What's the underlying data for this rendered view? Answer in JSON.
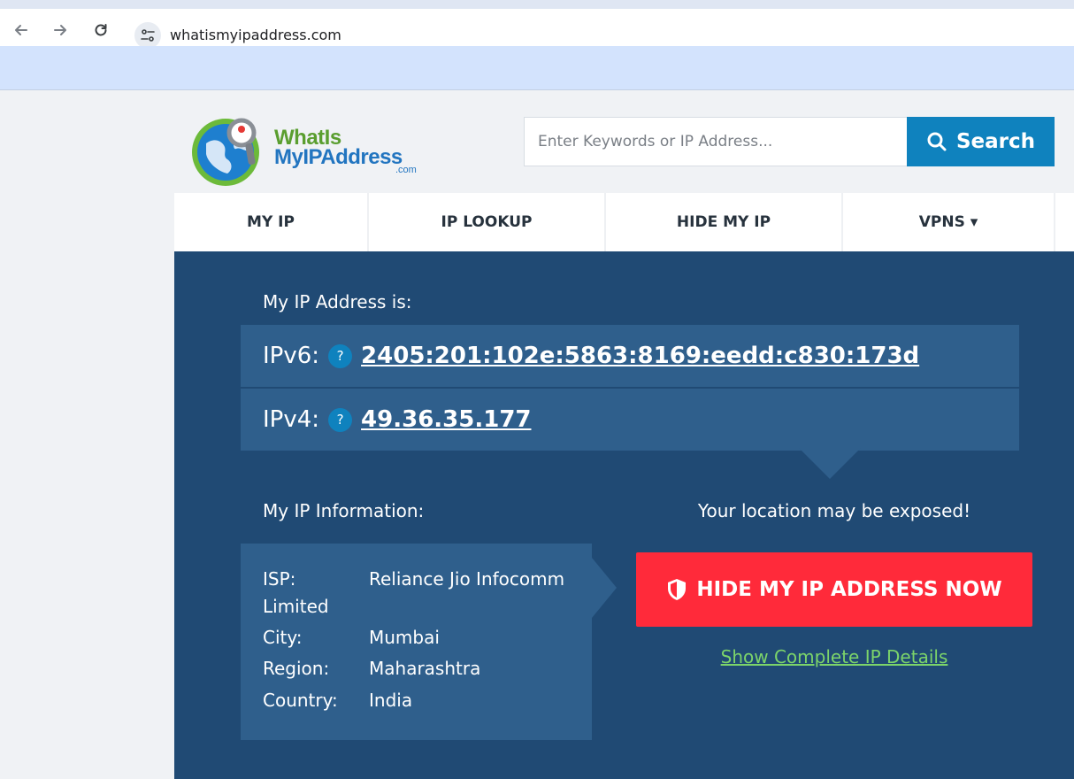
{
  "browser": {
    "url": "whatismyipaddress.com",
    "icons": [
      "back-arrow-icon",
      "forward-arrow-icon",
      "reload-icon",
      "site-settings-icon",
      "apps-grid-icon"
    ]
  },
  "site": {
    "logo": {
      "line1": "WhatIs",
      "line2": "MyIPAddress",
      "line3": ".com"
    },
    "search": {
      "placeholder": "Enter Keywords or IP Address...",
      "button_label": "Search"
    },
    "nav": [
      {
        "label": "MY IP"
      },
      {
        "label": "IP LOOKUP"
      },
      {
        "label": "HIDE MY IP"
      },
      {
        "label": "VPNS ▾"
      }
    ]
  },
  "hero": {
    "heading": "My IP Address is:",
    "ipv6": {
      "label": "IPv6:",
      "help": "?",
      "value": "2405:201:102e:5863:8169:eedd:c830:173d"
    },
    "ipv4": {
      "label": "IPv4:",
      "help": "?",
      "value": "49.36.35.177"
    },
    "info_heading": "My IP Information:",
    "warning": "Your location may be exposed!",
    "info": {
      "isp_label": "ISP:",
      "isp_value": "Reliance Jio Infocomm",
      "isp_value_cont": "Limited",
      "city_label": "City:",
      "city_value": "Mumbai",
      "region_label": "Region:",
      "region_value": "Maharashtra",
      "country_label": "Country:",
      "country_value": "India"
    },
    "hide_button": "HIDE MY IP ADDRESS NOW",
    "details_link": "Show Complete IP Details"
  },
  "colors": {
    "hero_bg": "#204a74",
    "panel_bg": "#2f5f8c",
    "accent_blue": "#0f82be",
    "cta_red": "#ff2a3a",
    "link_green": "#7cd46a"
  }
}
